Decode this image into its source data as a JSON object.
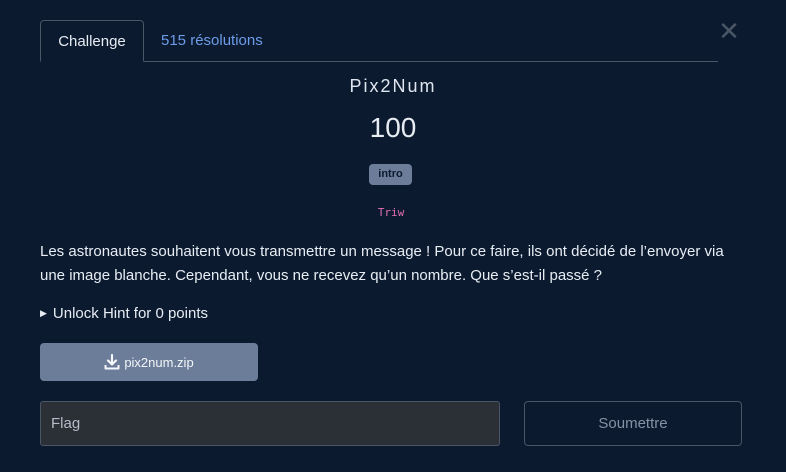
{
  "tabs": [
    {
      "label": "Challenge",
      "active": true
    },
    {
      "label": "515 résolutions",
      "active": false
    }
  ],
  "close_icon": "close-icon",
  "challenge": {
    "name": "Pix2Num",
    "points": "100",
    "tag": "intro",
    "author": "Triw",
    "description": "Les astronautes souhaitent vous transmettre un message ! Pour ce faire, ils ont décidé de l’envoyer via une image blanche. Cependant, vous ne recevez qu’un nombre. Que s’est-il passé ?",
    "hint_label": "Unlock Hint for 0 points",
    "file_label": "pix2num.zip"
  },
  "form": {
    "flag_placeholder": "Flag",
    "flag_value": "",
    "submit_label": "Soumettre"
  },
  "colors": {
    "background": "#0b1a2f",
    "link": "#6d9ce8",
    "tag": "#6c7d99",
    "author": "#e36fb6"
  }
}
